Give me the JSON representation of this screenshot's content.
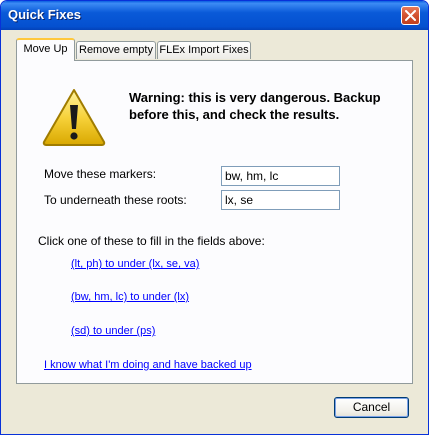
{
  "window": {
    "title": "Quick Fixes"
  },
  "tabs": [
    {
      "label": "Move Up",
      "active": true
    },
    {
      "label": "Remove empty",
      "active": false
    },
    {
      "label": "FLEx Import Fixes",
      "active": false
    }
  ],
  "panel": {
    "warning": "Warning: this is very dangerous. Backup before this, and check the results.",
    "markers_label": "Move these markers:",
    "markers_value": "bw, hm, lc",
    "roots_label": "To underneath these roots:",
    "roots_value": "lx, se",
    "instructions": "Click one of these to fill in the fields above:",
    "presets": [
      "(lt, ph) to under (lx, se, va)",
      "(bw, hm, lc) to under (lx)",
      "(sd) to under (ps)"
    ],
    "confirm_link": "I know what I'm doing and have backed up"
  },
  "buttons": {
    "cancel": "Cancel"
  },
  "icons": {
    "warning": "warning-triangle-icon",
    "close": "close-x-icon"
  },
  "colors": {
    "titlebar": "#0a5ad8",
    "link": "#0000ff",
    "active_tab_accent": "#ffc83c",
    "close_button": "#d2512f"
  }
}
